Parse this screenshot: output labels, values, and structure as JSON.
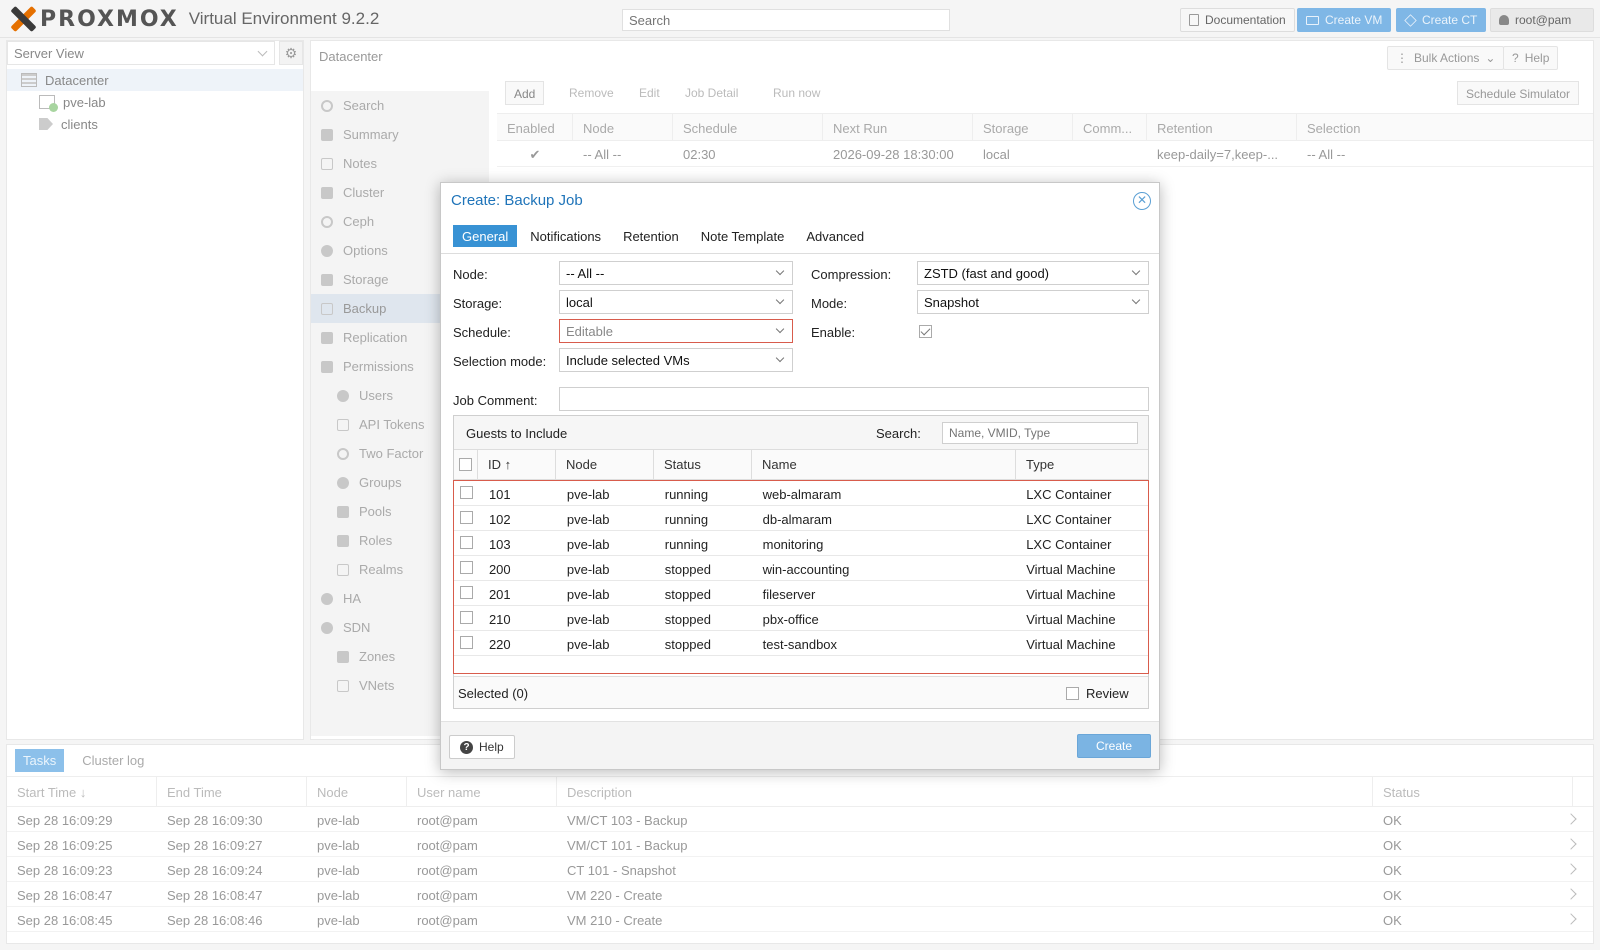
{
  "topbar": {
    "logo_text": "PROXMOX",
    "product": "Virtual Environment 9.2.2",
    "search_placeholder": "Search",
    "documentation": "Documentation",
    "create_vm": "Create VM",
    "create_ct": "Create CT",
    "user": "root@pam"
  },
  "left": {
    "view": "Server View",
    "tree": [
      "Datacenter",
      "pve-lab",
      "clients"
    ]
  },
  "content": {
    "title": "Datacenter",
    "bulk_actions": "Bulk Actions",
    "help": "Help",
    "nav": [
      "Search",
      "Summary",
      "Notes",
      "Cluster",
      "Ceph",
      "Options",
      "Storage",
      "Backup",
      "Replication",
      "Permissions",
      "Users",
      "API Tokens",
      "Two Factor",
      "Groups",
      "Pools",
      "Roles",
      "Realms",
      "HA",
      "SDN",
      "Zones",
      "VNets"
    ],
    "toolbar": [
      "Add",
      "Remove",
      "Edit",
      "Job Detail",
      "Run now",
      "Schedule Simulator"
    ],
    "columns": [
      "Enabled",
      "Node",
      "Schedule",
      "Next Run",
      "Storage",
      "Comm...",
      "Retention",
      "Selection"
    ],
    "row": {
      "enabled": "✔",
      "node": "-- All --",
      "schedule": "02:30",
      "next_run": "2026-09-28 18:30:00",
      "storage": "local",
      "comment": "",
      "retention": "keep-daily=7,keep-...",
      "selection": "-- All --"
    }
  },
  "tasks": {
    "tabs": [
      "Tasks",
      "Cluster log"
    ],
    "columns": [
      "Start Time ↓",
      "End Time",
      "Node",
      "User name",
      "Description",
      "Status"
    ],
    "rows": [
      [
        "Sep 28 16:09:29",
        "Sep 28 16:09:30",
        "pve-lab",
        "root@pam",
        "VM/CT 103 - Backup",
        "OK"
      ],
      [
        "Sep 28 16:09:25",
        "Sep 28 16:09:27",
        "pve-lab",
        "root@pam",
        "VM/CT 101 - Backup",
        "OK"
      ],
      [
        "Sep 28 16:09:23",
        "Sep 28 16:09:24",
        "pve-lab",
        "root@pam",
        "CT 101 - Snapshot",
        "OK"
      ],
      [
        "Sep 28 16:08:47",
        "Sep 28 16:08:47",
        "pve-lab",
        "root@pam",
        "VM 220 - Create",
        "OK"
      ],
      [
        "Sep 28 16:08:45",
        "Sep 28 16:08:46",
        "pve-lab",
        "root@pam",
        "VM 210 - Create",
        "OK"
      ]
    ]
  },
  "dialog": {
    "title": "Create: Backup Job",
    "tabs": [
      "General",
      "Notifications",
      "Retention",
      "Note Template",
      "Advanced"
    ],
    "labels": {
      "node": "Node:",
      "storage": "Storage:",
      "schedule": "Schedule:",
      "selection_mode": "Selection mode:",
      "compression": "Compression:",
      "mode": "Mode:",
      "enable": "Enable:",
      "job_comment": "Job Comment:"
    },
    "values": {
      "node": "-- All --",
      "storage": "local",
      "schedule": "Editable",
      "selection_mode": "Include selected VMs",
      "compression": "ZSTD (fast and good)",
      "mode": "Snapshot"
    },
    "guests": {
      "title": "Guests to Include",
      "search_label": "Search:",
      "search_placeholder": "Name, VMID, Type",
      "columns": [
        "ID ↑",
        "Node",
        "Status",
        "Name",
        "Type"
      ],
      "rows": [
        [
          "101",
          "pve-lab",
          "running",
          "web-almaram",
          "LXC Container"
        ],
        [
          "102",
          "pve-lab",
          "running",
          "db-almaram",
          "LXC Container"
        ],
        [
          "103",
          "pve-lab",
          "running",
          "monitoring",
          "LXC Container"
        ],
        [
          "200",
          "pve-lab",
          "stopped",
          "win-accounting",
          "Virtual Machine"
        ],
        [
          "201",
          "pve-lab",
          "stopped",
          "fileserver",
          "Virtual Machine"
        ],
        [
          "210",
          "pve-lab",
          "stopped",
          "pbx-office",
          "Virtual Machine"
        ],
        [
          "220",
          "pve-lab",
          "stopped",
          "test-sandbox",
          "Virtual Machine"
        ]
      ],
      "selected": "Selected (0)",
      "review": "Review"
    },
    "help": "Help",
    "create": "Create"
  }
}
